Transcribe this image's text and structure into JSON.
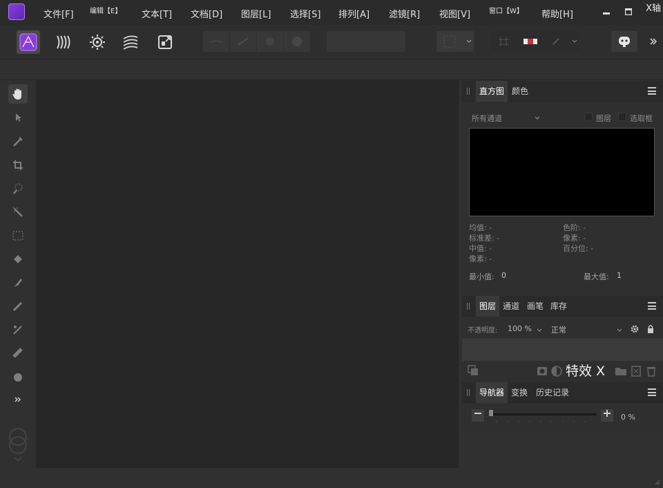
{
  "axis_label": "X轴",
  "menu": {
    "items": [
      {
        "label": "文件[F]",
        "small": false
      },
      {
        "label": "编辑【E】",
        "small": true
      },
      {
        "label": "文本[T]",
        "small": false
      },
      {
        "label": "文档[D]",
        "small": false
      },
      {
        "label": "图层[L]",
        "small": false
      },
      {
        "label": "选择[S]",
        "small": false
      },
      {
        "label": "排列[A]",
        "small": false
      },
      {
        "label": "滤镜[R]",
        "small": false
      },
      {
        "label": "视图[V]",
        "small": false
      },
      {
        "label": "窗口【W】",
        "small": true
      },
      {
        "label": "帮助[H]",
        "small": false
      }
    ]
  },
  "histogram_panel": {
    "tabs": [
      "直方图",
      "颜色"
    ],
    "channel_select": "所有通道",
    "checkbox_layer": "图层",
    "checkbox_selection": "选取框",
    "stats_left": [
      "均值: -",
      "标准差: -",
      "中值: -",
      "像素: -"
    ],
    "stats_right": [
      "色阶: -",
      "像素: -",
      "百分位: -"
    ],
    "min_label": "最小值:",
    "min_value": "0",
    "max_label": "最大值:",
    "max_value": "1"
  },
  "layers_panel": {
    "tabs": [
      "图层",
      "通道",
      "画笔",
      "库存"
    ],
    "opacity_label": "不透明度:",
    "opacity_value": "100 %",
    "blend_mode": "正常",
    "fx_label": "特效 X"
  },
  "navigator_panel": {
    "tabs": [
      "导航器",
      "变换",
      "历史记录"
    ],
    "zoom_value": "0 %"
  },
  "colors": {
    "accent_purple": "#8a3cd9"
  }
}
